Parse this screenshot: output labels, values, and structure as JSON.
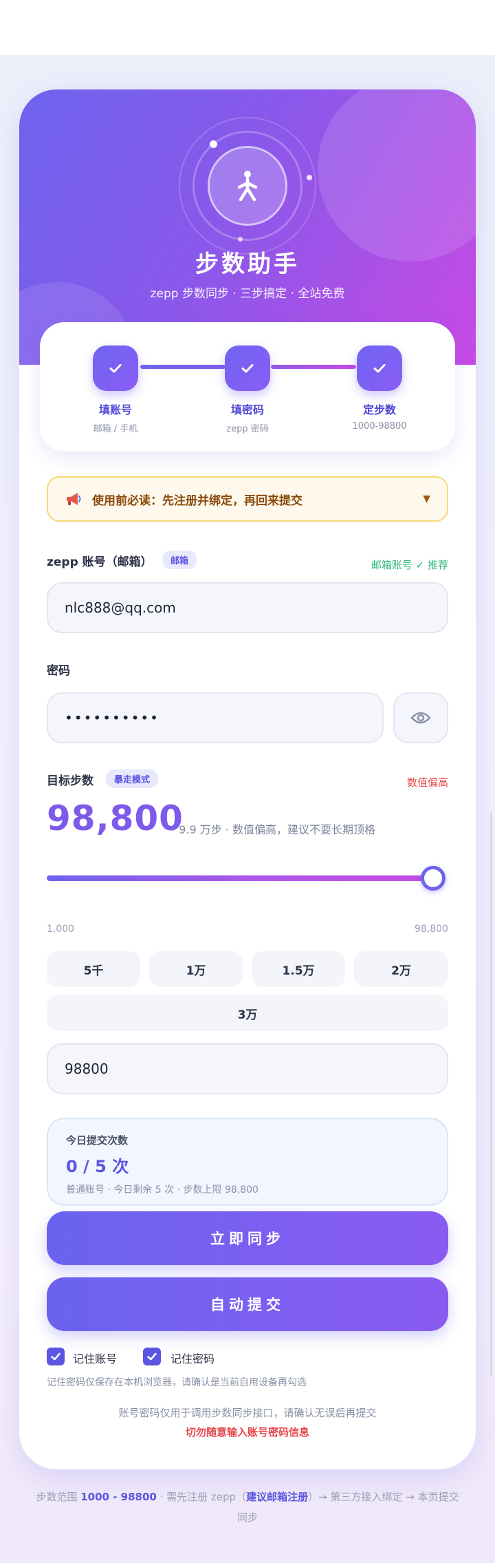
{
  "app": {
    "title": "步数助手",
    "subtitle": "zepp 步数同步 · 三步搞定 · 全站免费"
  },
  "steps": [
    {
      "title": "填账号",
      "sub": "邮箱 / 手机"
    },
    {
      "title": "填密码",
      "sub": "zepp 密码"
    },
    {
      "title": "定步数",
      "sub": "1000-98800"
    }
  ],
  "notice": {
    "icon": "megaphone-icon",
    "text": "使用前必读：先注册并绑定，再回来提交",
    "caret": "▼"
  },
  "account": {
    "label": "zepp 账号（邮箱）",
    "tag": "邮箱",
    "hint": "邮箱账号 ✓ 推荐",
    "value": "nlc888@qq.com"
  },
  "password": {
    "label": "密码",
    "value": "••••••••••",
    "toggle_icon": "eye-icon"
  },
  "target": {
    "label": "目标步数",
    "tag": "暴走模式",
    "warning": "数值偏高",
    "value_display": "98,800",
    "note": "· 9.9 万步 · 数值偏高，建议不要长期顶格",
    "slider_value": 98800,
    "slider_min": 1000,
    "slider_max": 98800,
    "min_label": "1,000",
    "max_label": "98,800",
    "presets": [
      "5千",
      "1万",
      "1.5万",
      "2万",
      "3万"
    ],
    "input_value": "98800"
  },
  "quota": {
    "title": "今日提交次数",
    "count": "0 / 5 次",
    "sub": "普通账号 · 今日剩余 5 次 · 步数上限 98,800"
  },
  "actions": {
    "sync_now": "立即同步",
    "auto_submit": "自动提交"
  },
  "options": {
    "remember_account": "记住账号",
    "remember_password": "记住密码",
    "remember_note": "记住密码仅保存在本机浏览器，请确认是当前自用设备再勾选"
  },
  "disclaimer": {
    "line1": "账号密码仅用于调用步数同步接口，请确认无误后再提交",
    "line2": "切勿随意输入账号密码信息"
  },
  "footer": {
    "p1": "步数范围 ",
    "range": "1000 - 98800",
    "p2": " · 需先注册 zepp（",
    "reg": "建议邮箱注册",
    "p3": "）→ 第三方接入绑定 → 本页提交同步"
  },
  "colors": {
    "accent": "#6d63ee",
    "accent_end": "#c74ae3",
    "warning": "#e5484d",
    "success": "#2fb87a"
  }
}
